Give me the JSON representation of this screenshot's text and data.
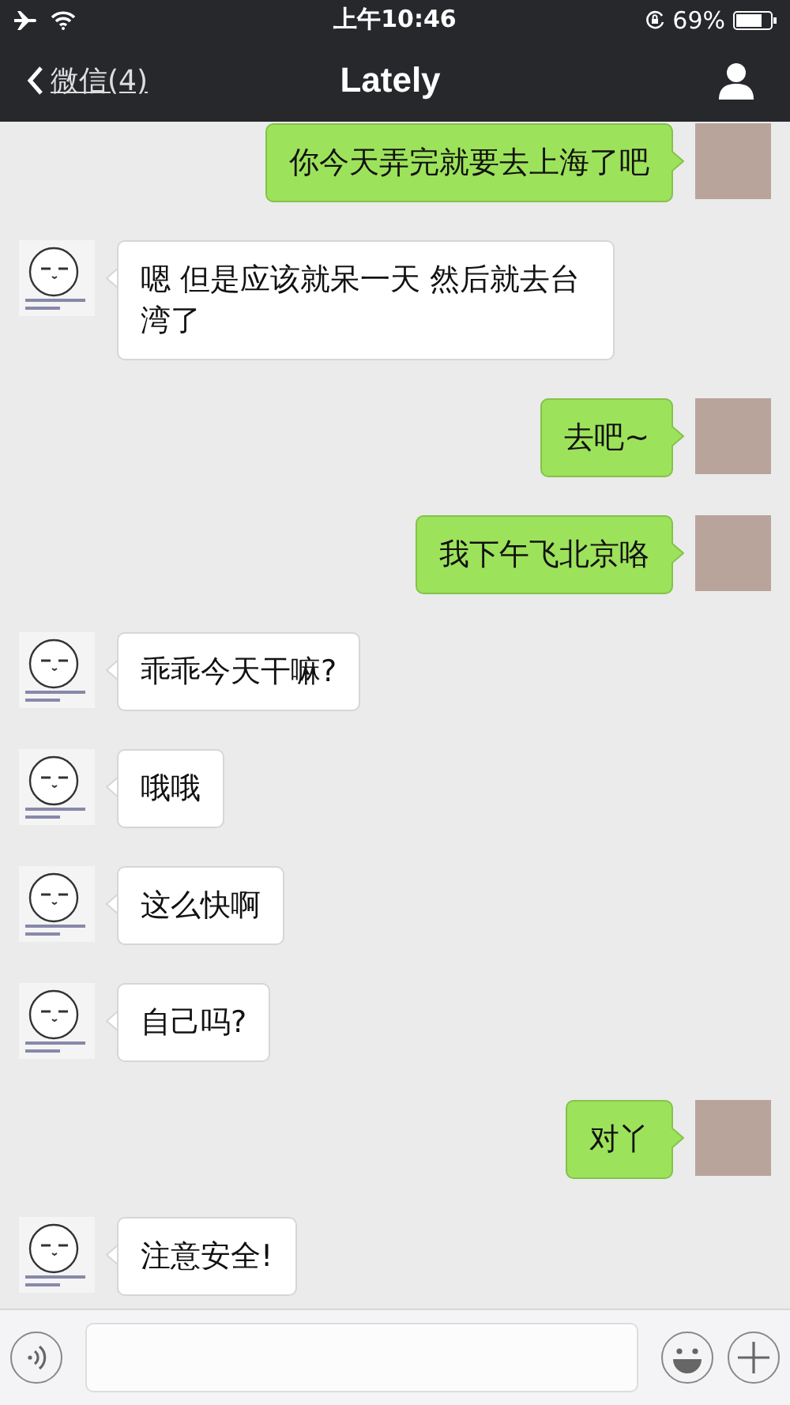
{
  "status_bar": {
    "time": "上午10:46",
    "battery": "69%"
  },
  "nav": {
    "back": "微信(4)",
    "title": "Lately"
  },
  "messages": [
    {
      "kind": "sent",
      "text": "你今天弄完就要去上海了吧"
    },
    {
      "kind": "received",
      "text": "嗯 但是应该就呆一天 然后就去台湾了"
    },
    {
      "kind": "sent",
      "text": "去吧~"
    },
    {
      "kind": "sent",
      "text": "我下午飞北京咯"
    },
    {
      "kind": "received",
      "text": "乖乖今天干嘛?"
    },
    {
      "kind": "received",
      "text": "哦哦"
    },
    {
      "kind": "received",
      "text": "这么快啊"
    },
    {
      "kind": "received",
      "text": "自己吗?"
    },
    {
      "kind": "sent",
      "text": "对丫"
    },
    {
      "kind": "received",
      "text": "注意安全!"
    }
  ]
}
